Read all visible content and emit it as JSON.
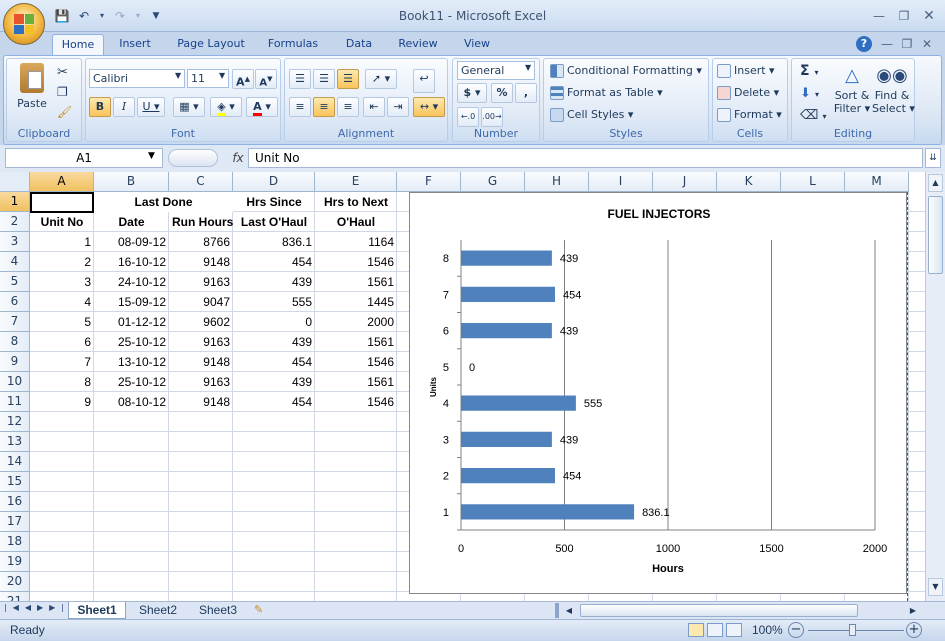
{
  "window": {
    "app_title": "Book11 - Microsoft Excel",
    "qat": [
      "save-icon",
      "undo-icon",
      "redo-icon",
      "customize-icon"
    ]
  },
  "tabs": [
    "Home",
    "Insert",
    "Page Layout",
    "Formulas",
    "Data",
    "Review",
    "View"
  ],
  "ribbon": {
    "clipboard": {
      "label": "Clipboard",
      "paste": "Paste"
    },
    "font": {
      "label": "Font",
      "name": "Calibri",
      "size": "11"
    },
    "alignment": {
      "label": "Alignment"
    },
    "number": {
      "label": "Number",
      "format": "General",
      "currency": "$",
      "percent": "%",
      "comma": ","
    },
    "styles": {
      "label": "Styles",
      "conditional": "Conditional Formatting",
      "format_table": "Format as Table",
      "cell_styles": "Cell Styles"
    },
    "cells": {
      "label": "Cells",
      "insert": "Insert",
      "delete": "Delete",
      "format": "Format"
    },
    "editing": {
      "label": "Editing",
      "sum": "Σ",
      "sort": "Sort &",
      "sort2": "Filter",
      "find": "Find &",
      "find2": "Select"
    }
  },
  "formula_bar": {
    "name_box": "A1",
    "fx": "fx",
    "value": "Unit No"
  },
  "columns": [
    "A",
    "B",
    "C",
    "D",
    "E",
    "F",
    "G",
    "H",
    "I",
    "J",
    "K",
    "L",
    "M"
  ],
  "rows": [
    "1",
    "2",
    "3",
    "4",
    "5",
    "6",
    "7",
    "8",
    "9",
    "10",
    "11",
    "12",
    "13",
    "14",
    "15",
    "16",
    "17",
    "18",
    "19",
    "20",
    "21"
  ],
  "table": {
    "header1": {
      "b": "Last Done",
      "d": "Hrs Since",
      "e": "Hrs to Next"
    },
    "header2": {
      "a": "Unit No",
      "b": "Date",
      "c": "Run Hours",
      "d": "Last O'Haul",
      "e": "O'Haul"
    },
    "data": [
      [
        "1",
        "08-09-12",
        "8766",
        "836.1",
        "1164"
      ],
      [
        "2",
        "16-10-12",
        "9148",
        "454",
        "1546"
      ],
      [
        "3",
        "24-10-12",
        "9163",
        "439",
        "1561"
      ],
      [
        "4",
        "15-09-12",
        "9047",
        "555",
        "1445"
      ],
      [
        "5",
        "01-12-12",
        "9602",
        "0",
        "2000"
      ],
      [
        "6",
        "25-10-12",
        "9163",
        "439",
        "1561"
      ],
      [
        "7",
        "13-10-12",
        "9148",
        "454",
        "1546"
      ],
      [
        "8",
        "25-10-12",
        "9163",
        "439",
        "1561"
      ],
      [
        "9",
        "08-10-12",
        "9148",
        "454",
        "1546"
      ]
    ]
  },
  "chart_data": {
    "type": "bar",
    "orientation": "horizontal",
    "title": "FUEL INJECTORS",
    "xlabel": "Hours",
    "ylabel": "Units",
    "categories": [
      "1",
      "2",
      "3",
      "4",
      "5",
      "6",
      "7",
      "8"
    ],
    "values": [
      836.1,
      454,
      439,
      555,
      0,
      439,
      454,
      439
    ],
    "xlim": [
      0,
      2000
    ],
    "xticks": [
      "0",
      "500",
      "1000",
      "1500",
      "2000"
    ],
    "grid": "vertical",
    "bar_color": "#4f81bd"
  },
  "sheets": [
    "Sheet1",
    "Sheet2",
    "Sheet3"
  ],
  "status": {
    "text": "Ready",
    "zoom": "100%"
  }
}
